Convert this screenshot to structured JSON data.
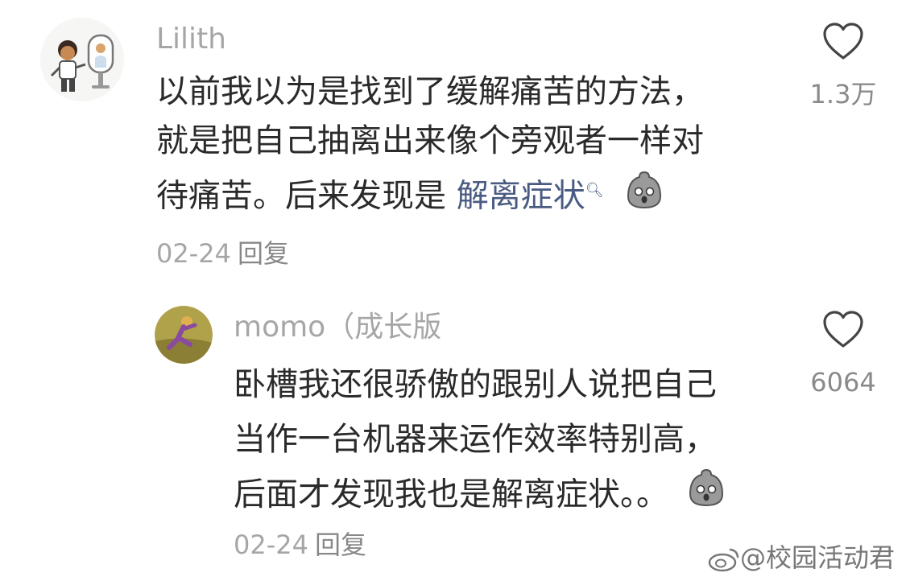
{
  "comments": [
    {
      "username": "Lilith",
      "lines": [
        "以前我以为是找到了缓解痛苦的方法，",
        "就是把自己抽离出来像个旁观者一样对"
      ],
      "last_line_prefix": "待痛苦。后来发现是 ",
      "link_text": "解离症状",
      "date": "02-24",
      "reply_label": "回复",
      "likes": "1.3万"
    },
    {
      "username": "momo（成长版",
      "lines": [
        "卧槽我还很骄傲的跟别人说把自己",
        "当作一台机器来运作效率特别高，"
      ],
      "last_line_prefix": "后面才发现我也是解离症状。。",
      "date": "02-24",
      "reply_label": "回复",
      "likes": "6064"
    }
  ],
  "watermark": "@校园活动君",
  "icons": {
    "like": "heart-outline-icon",
    "emoji": "shocked-blob-emoji",
    "search": "search-icon"
  },
  "colors": {
    "username": "#a6a6a6",
    "text": "#2a2a2a",
    "link": "#4a5b83",
    "meta": "#a6a6a6"
  }
}
